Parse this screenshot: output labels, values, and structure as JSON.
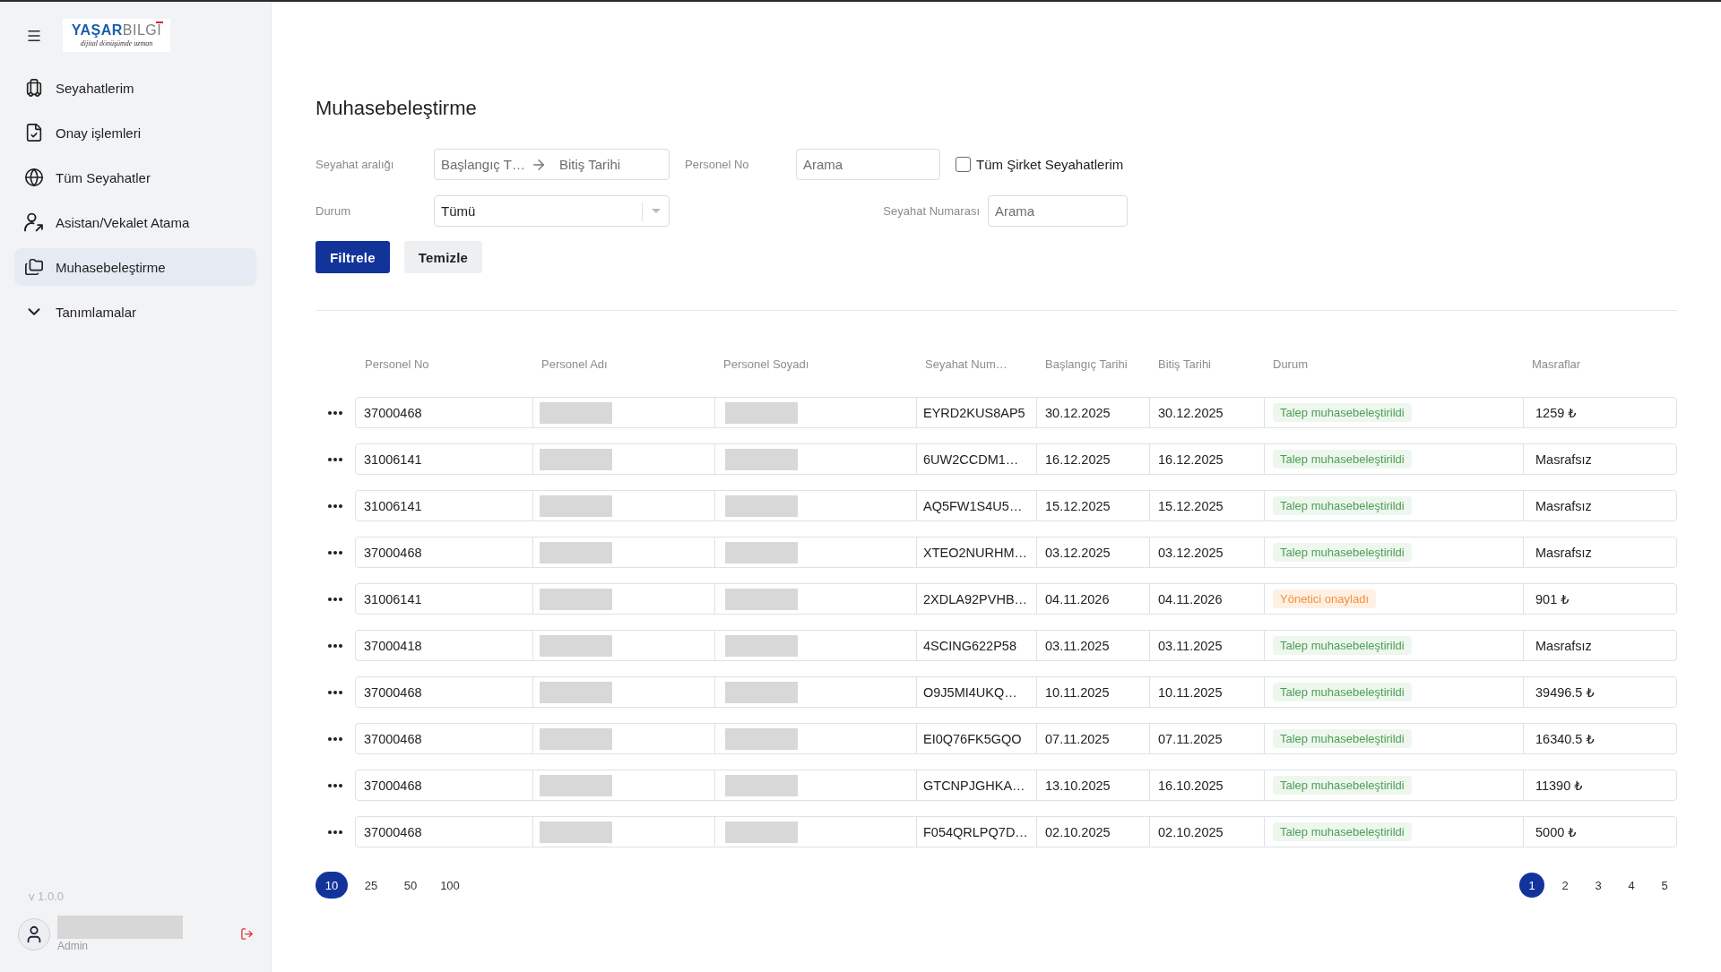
{
  "sidebar": {
    "logo": {
      "brand_left": "YAŞAR",
      "brand_right": "BILGI",
      "tagline": "dijital dönüşümde uzman"
    },
    "nav_items": [
      {
        "label": "Seyahatlerim",
        "kind": "link",
        "selected": false
      },
      {
        "label": "Onay işlemleri",
        "kind": "link",
        "selected": false
      },
      {
        "label": "Tüm Seyahatler",
        "kind": "link",
        "selected": false
      },
      {
        "label": "Asistan/Vekalet Atama",
        "kind": "link",
        "selected": false
      },
      {
        "label": "Muhasebeleştirme",
        "kind": "link",
        "selected": true
      },
      {
        "label": "Tanımlamalar",
        "kind": "group",
        "selected": false,
        "expanded": false
      }
    ],
    "version": "v 1.0.0",
    "user": {
      "role": "Admin"
    }
  },
  "page": {
    "title": "Muhasebeleştirme"
  },
  "filters": {
    "travel_range": {
      "label": "Seyahat aralığı",
      "start_placeholder": "Başlangıç T…",
      "end_placeholder": "Bitiş Tarihi"
    },
    "personnel_no": {
      "label": "Personel No",
      "placeholder": "Arama"
    },
    "all_company_travels": {
      "label": "Tüm Şirket Seyahatlerim",
      "checked": false
    },
    "status": {
      "label": "Durum",
      "value": "Tümü"
    },
    "travel_number": {
      "label": "Seyahat Numarası",
      "placeholder": "Arama"
    },
    "buttons": [
      {
        "label": "Filtrele",
        "kind": "primary"
      },
      {
        "label": "Temizle",
        "kind": "secondary"
      }
    ]
  },
  "table": {
    "columns": [
      "Personel No",
      "Personel Adı",
      "Personel Soyadı",
      "Seyahat Num…",
      "Başlangıç Tarihi",
      "Bitiş Tarihi",
      "Durum",
      "Masraflar"
    ],
    "rows": [
      {
        "personnel_no": "37000468",
        "travel_no": "EYRD2KUS8AP5",
        "start_date": "30.12.2025",
        "end_date": "30.12.2025",
        "status": {
          "label": "Talep muhasebeleştirildi",
          "kind": "accounted"
        },
        "expenses": "1259 ₺"
      },
      {
        "personnel_no": "31006141",
        "travel_no": "6UW2CCDM1…",
        "start_date": "16.12.2025",
        "end_date": "16.12.2025",
        "status": {
          "label": "Talep muhasebeleştirildi",
          "kind": "accounted"
        },
        "expenses": "Masrafsız"
      },
      {
        "personnel_no": "31006141",
        "travel_no": "AQ5FW1S4U5…",
        "start_date": "15.12.2025",
        "end_date": "15.12.2025",
        "status": {
          "label": "Talep muhasebeleştirildi",
          "kind": "accounted"
        },
        "expenses": "Masrafsız"
      },
      {
        "personnel_no": "37000468",
        "travel_no": "XTEO2NURHM…",
        "start_date": "03.12.2025",
        "end_date": "03.12.2025",
        "status": {
          "label": "Talep muhasebeleştirildi",
          "kind": "accounted"
        },
        "expenses": "Masrafsız"
      },
      {
        "personnel_no": "31006141",
        "travel_no": "2XDLA92PVHB…",
        "start_date": "04.11.2026",
        "end_date": "04.11.2026",
        "status": {
          "label": "Yönetici onayladı",
          "kind": "manager_approved"
        },
        "expenses": "901 ₺"
      },
      {
        "personnel_no": "37000418",
        "travel_no": "4SCING622P58",
        "start_date": "03.11.2025",
        "end_date": "03.11.2025",
        "status": {
          "label": "Talep muhasebeleştirildi",
          "kind": "accounted"
        },
        "expenses": "Masrafsız"
      },
      {
        "personnel_no": "37000468",
        "travel_no": "O9J5MI4UKQ…",
        "start_date": "10.11.2025",
        "end_date": "10.11.2025",
        "status": {
          "label": "Talep muhasebeleştirildi",
          "kind": "accounted"
        },
        "expenses": "39496.5 ₺"
      },
      {
        "personnel_no": "37000468",
        "travel_no": "EI0Q76FK5GQO",
        "start_date": "07.11.2025",
        "end_date": "07.11.2025",
        "status": {
          "label": "Talep muhasebeleştirildi",
          "kind": "accounted"
        },
        "expenses": "16340.5 ₺"
      },
      {
        "personnel_no": "37000468",
        "travel_no": "GTCNPJGHKA…",
        "start_date": "13.10.2025",
        "end_date": "16.10.2025",
        "status": {
          "label": "Talep muhasebeleştirildi",
          "kind": "accounted"
        },
        "expenses": "11390 ₺"
      },
      {
        "personnel_no": "37000468",
        "travel_no": "F054QRLPQ7D…",
        "start_date": "02.10.2025",
        "end_date": "02.10.2025",
        "status": {
          "label": "Talep muhasebeleştirildi",
          "kind": "accounted"
        },
        "expenses": "5000 ₺"
      }
    ]
  },
  "pagination": {
    "page_sizes": [
      {
        "label": "10",
        "selected": true
      },
      {
        "label": "25",
        "selected": false
      },
      {
        "label": "50",
        "selected": false
      },
      {
        "label": "100",
        "selected": false
      }
    ],
    "pages": [
      {
        "label": "1",
        "selected": true
      },
      {
        "label": "2",
        "selected": false
      },
      {
        "label": "3",
        "selected": false
      },
      {
        "label": "4",
        "selected": false
      },
      {
        "label": "5",
        "selected": false
      }
    ]
  }
}
